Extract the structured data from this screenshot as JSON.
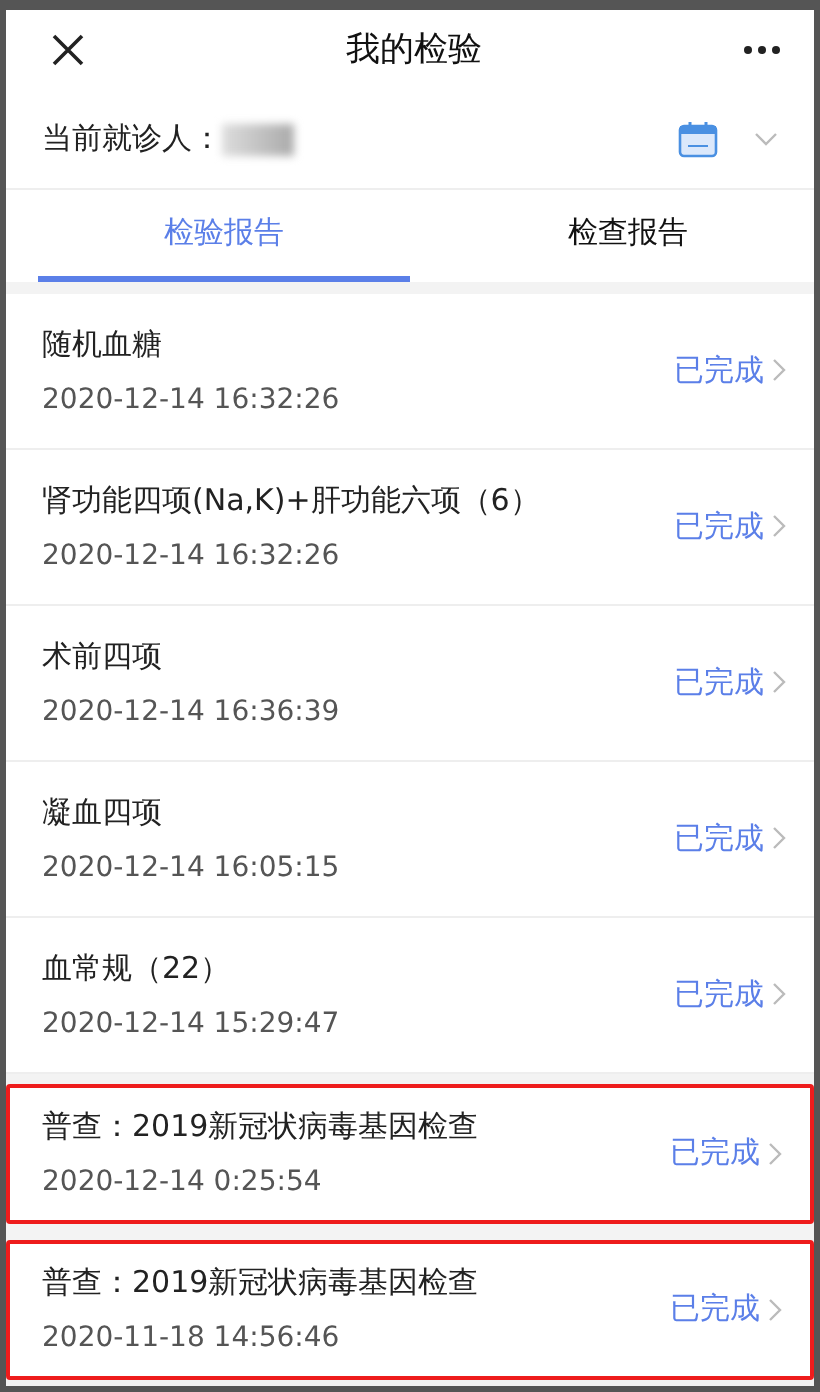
{
  "header": {
    "title": "我的检验"
  },
  "patient": {
    "label": "当前就诊人："
  },
  "tabs": [
    {
      "label": "检验报告",
      "selected": true
    },
    {
      "label": "检查报告",
      "selected": false
    }
  ],
  "reports": [
    {
      "name": "随机血糖",
      "time": "2020-12-14 16:32:26",
      "status": "已完成",
      "highlighted": false
    },
    {
      "name": "肾功能四项(Na,K)+肝功能六项（6）",
      "time": "2020-12-14 16:32:26",
      "status": "已完成",
      "highlighted": false
    },
    {
      "name": "术前四项",
      "time": "2020-12-14 16:36:39",
      "status": "已完成",
      "highlighted": false
    },
    {
      "name": "凝血四项",
      "time": "2020-12-14 16:05:15",
      "status": "已完成",
      "highlighted": false
    },
    {
      "name": "血常规（22）",
      "time": "2020-12-14 15:29:47",
      "status": "已完成",
      "highlighted": false
    },
    {
      "name": "普查：2019新冠状病毒基因检查",
      "time": "2020-12-14 0:25:54",
      "status": "已完成",
      "highlighted": true
    },
    {
      "name": "普查：2019新冠状病毒基因检查",
      "time": "2020-11-18 14:56:46",
      "status": "已完成",
      "highlighted": true
    }
  ]
}
